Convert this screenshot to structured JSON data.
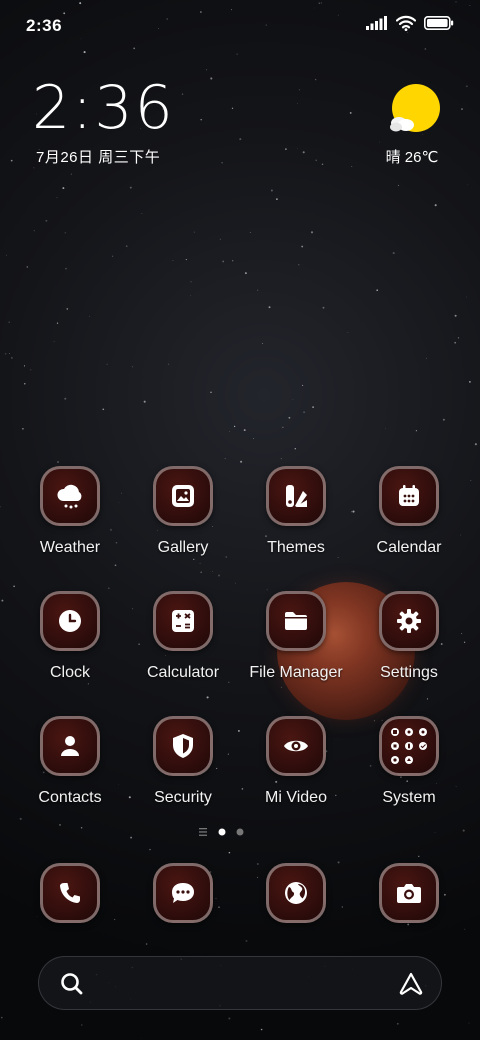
{
  "status_bar": {
    "time": "2:36",
    "icons": [
      "signal-icon",
      "wifi-icon",
      "battery-icon"
    ]
  },
  "clock_widget": {
    "time": "2:36",
    "date": "7月26日 周三下午"
  },
  "weather_widget": {
    "icon": "sun-cloud-icon",
    "text": "晴 26℃"
  },
  "apps": [
    {
      "label": "Weather",
      "icon": "weather-icon"
    },
    {
      "label": "Gallery",
      "icon": "gallery-icon"
    },
    {
      "label": "Themes",
      "icon": "themes-icon"
    },
    {
      "label": "Calendar",
      "icon": "calendar-icon"
    },
    {
      "label": "Clock",
      "icon": "clock-icon"
    },
    {
      "label": "Calculator",
      "icon": "calculator-icon"
    },
    {
      "label": "File Manager",
      "icon": "folder-icon"
    },
    {
      "label": "Settings",
      "icon": "gear-icon"
    },
    {
      "label": "Contacts",
      "icon": "person-icon"
    },
    {
      "label": "Security",
      "icon": "shield-icon"
    },
    {
      "label": "Mi Video",
      "icon": "eye-icon"
    },
    {
      "label": "System",
      "icon": "folder-grid-icon"
    }
  ],
  "page_indicator": {
    "items": [
      "menu-lines-icon",
      "dot-active",
      "dot-inactive"
    ],
    "active_index": 1
  },
  "dock": [
    {
      "icon": "phone-icon"
    },
    {
      "icon": "message-icon"
    },
    {
      "icon": "globe-icon"
    },
    {
      "icon": "camera-icon"
    }
  ],
  "search_bar": {
    "left_icon": "search-icon",
    "right_icon": "assistant-icon"
  },
  "colors": {
    "icon_bg": "#3a100e",
    "icon_border": "#b9aaa8",
    "sun": "#ffd600",
    "text": "#ffffff"
  }
}
